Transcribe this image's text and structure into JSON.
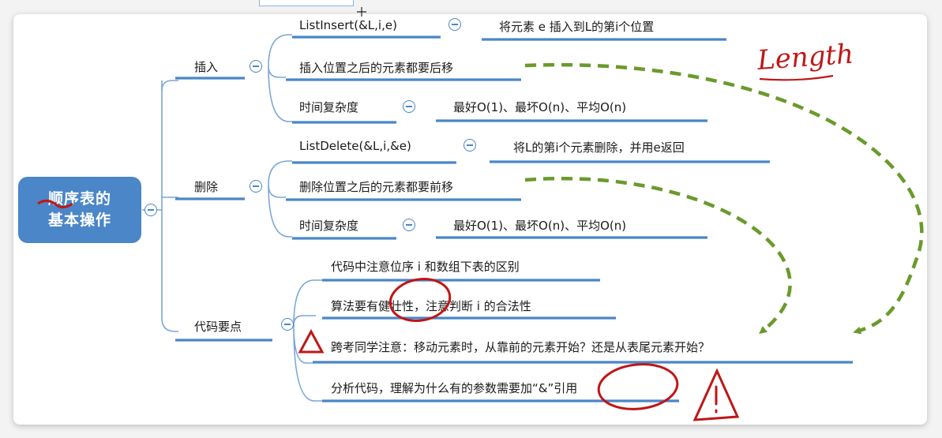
{
  "root": {
    "line1": "顺序表的",
    "line2": "基本操作"
  },
  "branches": {
    "insert": {
      "label": "插入",
      "items": [
        {
          "text": "ListInsert(&L,i,e)",
          "detail": "将元素 e 插入到L的第i个位置"
        },
        {
          "text": "插入位置之后的元素都要后移"
        },
        {
          "text": "时间复杂度",
          "detail": "最好O(1)、最坏O(n)、平均O(n)"
        }
      ]
    },
    "delete": {
      "label": "删除",
      "items": [
        {
          "text": "ListDelete(&L,i,&e)",
          "detail": "将L的第i个元素删除，并用e返回"
        },
        {
          "text": "删除位置之后的元素都要前移"
        },
        {
          "text": "时间复杂度",
          "detail": "最好O(1)、最坏O(n)、平均O(n)"
        }
      ]
    },
    "code": {
      "label": "代码要点",
      "items": [
        {
          "text": "代码中注意位序 i 和数组下表的区别"
        },
        {
          "text": "算法要有健壮性，注意判断 i 的合法性"
        },
        {
          "text": "跨考同学注意：移动元素时，从靠前的元素开始？还是从表尾元素开始？"
        },
        {
          "text": "分析代码，理解为什么有的参数需要加“&”引用"
        }
      ]
    }
  },
  "annotations": {
    "handwriting": "Length"
  },
  "colors": {
    "root_fill": "#4a86c8",
    "underline": "#4a86c8",
    "connector": "#7ba6d8",
    "arrow_dash": "#6a9a2c",
    "ink": "#c01616"
  }
}
